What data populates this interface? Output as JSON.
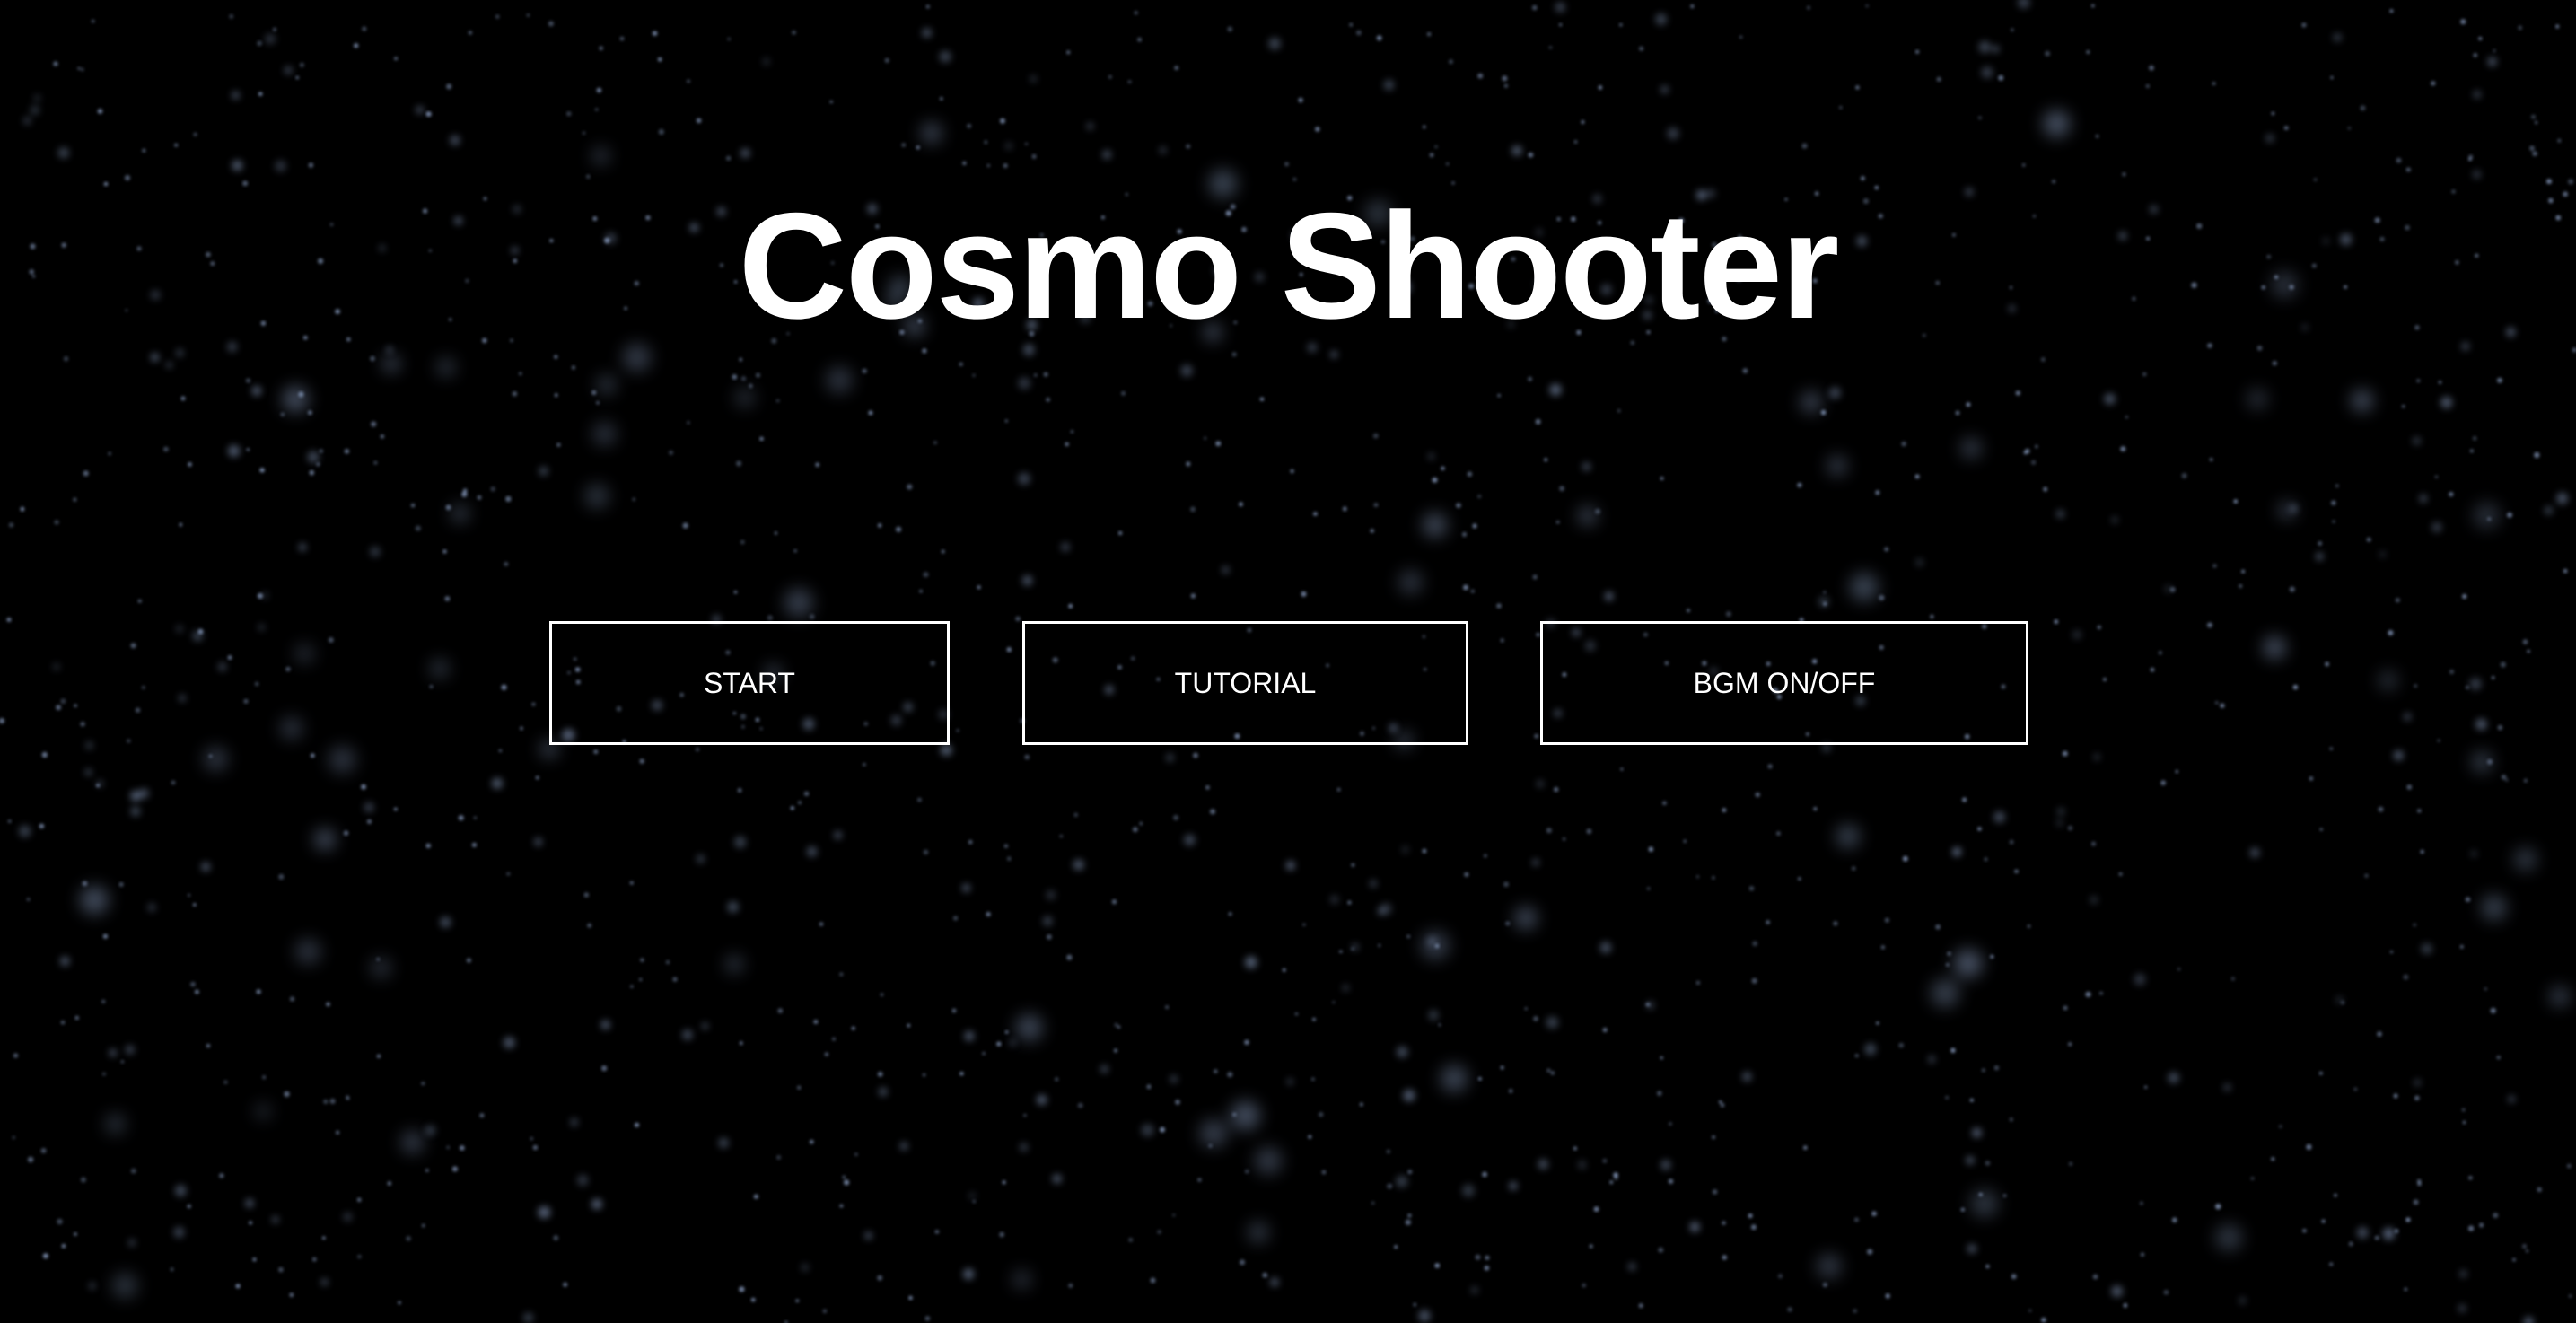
{
  "game": {
    "title": "Cosmo Shooter"
  },
  "menu": {
    "start_label": "START",
    "tutorial_label": "TUTORIAL",
    "bgm_label": "BGM ON/OFF"
  },
  "colors": {
    "background": "#000000",
    "text": "#ffffff",
    "button_border": "#ffffff",
    "star": "#9fb6e0"
  }
}
